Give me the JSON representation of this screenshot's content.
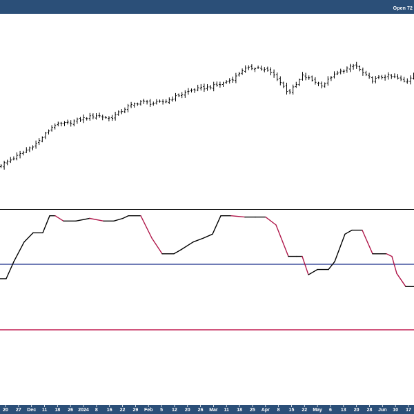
{
  "header": {
    "open_readout": "Open 72"
  },
  "colors": {
    "bar_bg": "#2b4f78",
    "price": "#000000",
    "osc_up": "#000000",
    "osc_down": "#b0174a",
    "mid_line": "#1a2f8a",
    "low_line": "#c21f52",
    "panel_border": "#000000"
  },
  "chart_data": [
    {
      "type": "ohlc",
      "panel": "price",
      "x_labels": [
        "20",
        "27",
        "Dec",
        "11",
        "18",
        "26",
        "2024",
        "8",
        "16",
        "22",
        "29",
        "Feb",
        "5",
        "12",
        "20",
        "26",
        "Mar",
        "11",
        "18",
        "25",
        "Apr",
        "8",
        "15",
        "22",
        "May",
        "6",
        "13",
        "20",
        "28",
        "Jun",
        "10",
        "17"
      ],
      "bold_labels": [
        "Dec",
        "2024",
        "Feb",
        "Mar",
        "Apr",
        "May",
        "Jun"
      ],
      "close_trace_norm": [
        [
          0,
          0.0
        ],
        [
          20,
          0.07
        ],
        [
          35,
          0.13
        ],
        [
          55,
          0.22
        ],
        [
          78,
          0.38
        ],
        [
          100,
          0.4
        ],
        [
          120,
          0.44
        ],
        [
          140,
          0.47
        ],
        [
          160,
          0.44
        ],
        [
          185,
          0.55
        ],
        [
          205,
          0.6
        ],
        [
          220,
          0.58
        ],
        [
          240,
          0.6
        ],
        [
          260,
          0.66
        ],
        [
          280,
          0.71
        ],
        [
          300,
          0.73
        ],
        [
          320,
          0.76
        ],
        [
          340,
          0.82
        ],
        [
          352,
          0.9
        ],
        [
          372,
          0.92
        ],
        [
          390,
          0.88
        ],
        [
          400,
          0.83
        ],
        [
          418,
          0.68
        ],
        [
          430,
          0.76
        ],
        [
          438,
          0.84
        ],
        [
          452,
          0.8
        ],
        [
          468,
          0.75
        ],
        [
          480,
          0.83
        ],
        [
          500,
          0.9
        ],
        [
          515,
          0.94
        ],
        [
          528,
          0.85
        ],
        [
          540,
          0.8
        ],
        [
          560,
          0.84
        ],
        [
          575,
          0.82
        ],
        [
          588,
          0.78
        ],
        [
          600,
          0.86
        ]
      ]
    },
    {
      "type": "line",
      "panel": "oscillator",
      "upper_level": 1.0,
      "middle_level": 0.5,
      "lower_level": 0.0,
      "trace_norm": [
        [
          0,
          0.39
        ],
        [
          9,
          0.39
        ],
        [
          20,
          0.52
        ],
        [
          35,
          0.67
        ],
        [
          48,
          0.74
        ],
        [
          62,
          0.74
        ],
        [
          72,
          0.87
        ],
        [
          80,
          0.87
        ],
        [
          92,
          0.83
        ],
        [
          110,
          0.83
        ],
        [
          130,
          0.85
        ],
        [
          150,
          0.83
        ],
        [
          165,
          0.83
        ],
        [
          178,
          0.85
        ],
        [
          186,
          0.87
        ],
        [
          204,
          0.87
        ],
        [
          220,
          0.7
        ],
        [
          235,
          0.58
        ],
        [
          252,
          0.58
        ],
        [
          262,
          0.61
        ],
        [
          280,
          0.67
        ],
        [
          295,
          0.7
        ],
        [
          308,
          0.73
        ],
        [
          320,
          0.87
        ],
        [
          335,
          0.87
        ],
        [
          355,
          0.86
        ],
        [
          370,
          0.86
        ],
        [
          385,
          0.86
        ],
        [
          400,
          0.8
        ],
        [
          418,
          0.56
        ],
        [
          430,
          0.56
        ],
        [
          438,
          0.56
        ],
        [
          447,
          0.42
        ],
        [
          460,
          0.46
        ],
        [
          476,
          0.46
        ],
        [
          485,
          0.52
        ],
        [
          500,
          0.73
        ],
        [
          510,
          0.76
        ],
        [
          525,
          0.76
        ],
        [
          540,
          0.58
        ],
        [
          560,
          0.58
        ],
        [
          568,
          0.56
        ],
        [
          575,
          0.43
        ],
        [
          588,
          0.33
        ],
        [
          600,
          0.33
        ]
      ]
    }
  ]
}
